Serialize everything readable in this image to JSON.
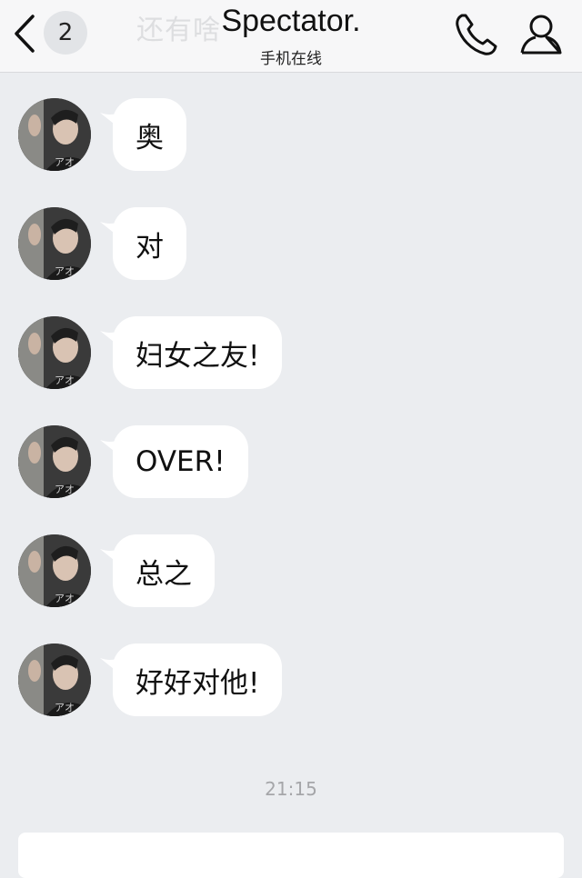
{
  "header": {
    "ghost_text": "还有啥",
    "unread_count": "2",
    "title": "Spectator.",
    "status": "手机在线"
  },
  "messages": [
    {
      "text": "奥"
    },
    {
      "text": "对"
    },
    {
      "text": "妇女之友!"
    },
    {
      "text": "OVER!"
    },
    {
      "text": "总之"
    },
    {
      "text": "好好对他!"
    }
  ],
  "timestamp": "21:15",
  "avatar": {
    "lettering": "アオ"
  },
  "colors": {
    "background": "#ebedf0",
    "bubble": "#ffffff",
    "header": "#f7f7f8"
  }
}
